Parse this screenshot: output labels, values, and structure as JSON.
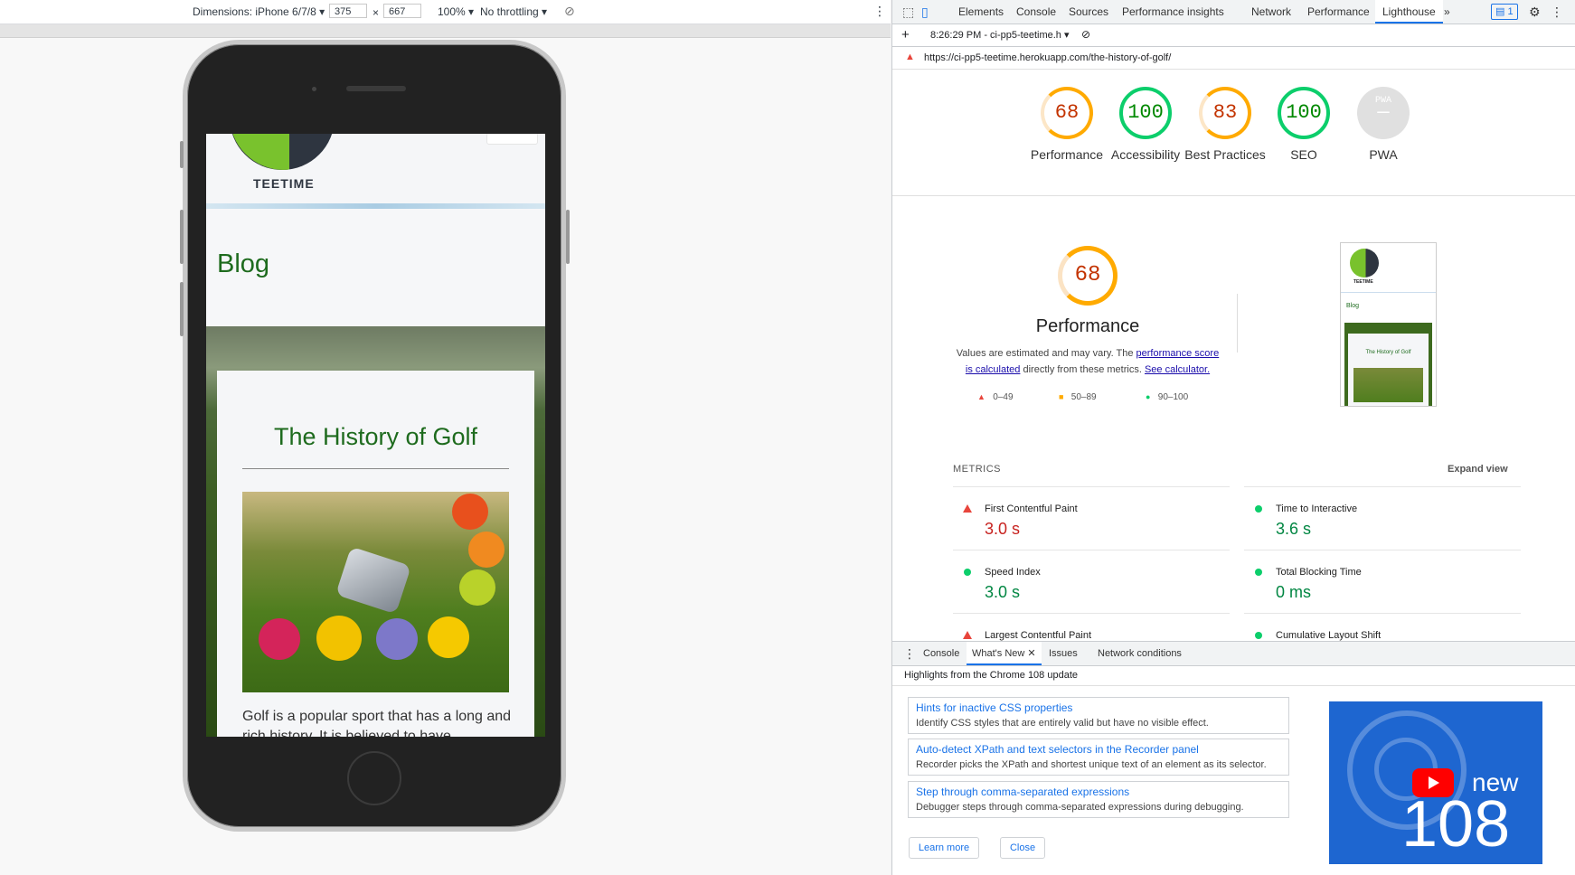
{
  "device_toolbar": {
    "dimensions_label": "Dimensions: iPhone 6/7/8",
    "width": "375",
    "times": "×",
    "height": "667",
    "zoom": "100%",
    "throttling": "No throttling"
  },
  "site": {
    "logo_text": "TEETIME",
    "blog_title": "Blog",
    "post_title": "The History of Golf",
    "post_text": "Golf is a popular sport that has a long and rich history. It is believed to have"
  },
  "devtools": {
    "tabs": [
      "Elements",
      "Console",
      "Sources",
      "Performance insights",
      "Network",
      "Performance",
      "Lighthouse"
    ],
    "active_tab": "Lighthouse",
    "issues_count": "1",
    "report_time": "8:26:29 PM - ci-pp5-teetime.h",
    "url": "https://ci-pp5-teetime.herokuapp.com/the-history-of-golf/",
    "scores": [
      {
        "value": "68",
        "label": "Performance",
        "level": "average"
      },
      {
        "value": "100",
        "label": "Accessibility",
        "level": "pass"
      },
      {
        "value": "83",
        "label": "Best Practices",
        "level": "average"
      },
      {
        "value": "100",
        "label": "SEO",
        "level": "pass"
      },
      {
        "value": "PWA",
        "label": "PWA",
        "level": "na"
      }
    ],
    "pwa_dash": "—",
    "performance": {
      "score": "68",
      "title": "Performance",
      "note_1": "Values are estimated and may vary. The ",
      "note_link_1": "performance score is calculated",
      "note_2": " directly from these metrics. ",
      "note_link_2": "See calculator.",
      "legend": [
        "0–49",
        "50–89",
        "90–100"
      ]
    },
    "thumbnail": {
      "logo_text": "TEETIME",
      "blog": "Blog",
      "post_title": "The History of Golf"
    },
    "metrics_header": "METRICS",
    "expand_view": "Expand view",
    "metrics": [
      {
        "name": "First Contentful Paint",
        "value": "3.0 s",
        "status": "fail"
      },
      {
        "name": "Time to Interactive",
        "value": "3.6 s",
        "status": "pass"
      },
      {
        "name": "Speed Index",
        "value": "3.0 s",
        "status": "pass"
      },
      {
        "name": "Total Blocking Time",
        "value": "0 ms",
        "status": "pass"
      },
      {
        "name": "Largest Contentful Paint",
        "value": "",
        "status": "fail"
      },
      {
        "name": "Cumulative Layout Shift",
        "value": "",
        "status": "pass"
      }
    ],
    "drawer": {
      "tabs": [
        "Console",
        "What's New",
        "Issues",
        "Network conditions"
      ],
      "active_tab": "What's New",
      "highlights": "Highlights from the Chrome 108 update",
      "items": [
        {
          "title": "Hints for inactive CSS properties",
          "desc": "Identify CSS styles that are entirely valid but have no visible effect."
        },
        {
          "title": "Auto-detect XPath and text selectors in the Recorder panel",
          "desc": "Recorder picks the XPath and shortest unique text of an element as its selector."
        },
        {
          "title": "Step through comma-separated expressions",
          "desc": "Debugger steps through comma-separated expressions during debugging."
        }
      ],
      "learn_more": "Learn more",
      "close": "Close",
      "video_new": "new",
      "video_version": "108"
    }
  }
}
